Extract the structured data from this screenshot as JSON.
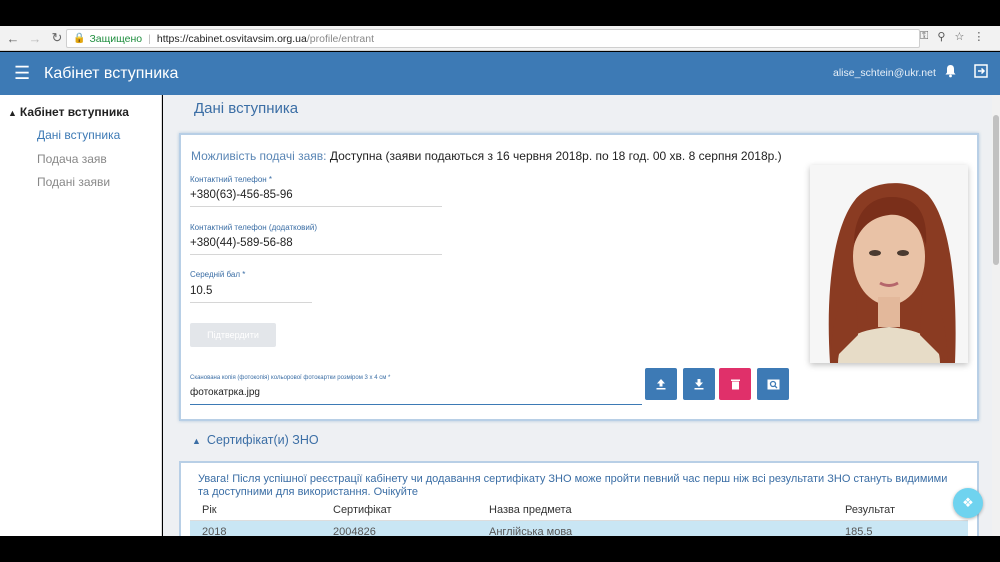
{
  "browser": {
    "secure_label": "Защищено",
    "url_host": "https://cabinet.osvitavsim.org.ua",
    "url_path": "/profile/entrant"
  },
  "header": {
    "title": "Кабінет вступника",
    "user_email": "alise_schtein@ukr.net"
  },
  "sidebar": {
    "heading": "Кабінет вступника",
    "items": [
      {
        "label": "Дані вступника"
      },
      {
        "label": "Подача заяв"
      },
      {
        "label": "Подані заяви"
      }
    ]
  },
  "main": {
    "page_title": "Дані вступника",
    "availability_label": "Можливість подачі заяв:",
    "availability_value": "Доступна (заяви подаються з 16 червня 2018р. по 18 год. 00 хв. 8 серпня 2018р.)",
    "phone_label": "Контактний телефон *",
    "phone_value": "+380(63)-456-85-96",
    "phone2_label": "Контактний телефон (додатковий)",
    "phone2_value": "+380(44)-589-56-88",
    "gpa_label": "Середній бал *",
    "gpa_value": "10.5",
    "confirm_label": "Підтвердити",
    "photo_label": "Сканована копія (фотокопія) кольорової фотокартки розміром 3 x 4 см *",
    "photo_file": "фотокатрка.jpg",
    "certificates_title": "Сертифікат(и) ЗНО",
    "warning": "Увага! Після успішної реєстрації кабінету чи додавання сертифікату ЗНО може пройти певний час перш ніж всі результати ЗНО стануть видимими та доступними для використання. Очікуйте",
    "table": {
      "headers": [
        "Рік",
        "Сертифікат",
        "Назва предмета",
        "Результат"
      ],
      "rows": [
        [
          "2018",
          "2004826",
          "Англійська мова",
          "185.5"
        ]
      ]
    }
  },
  "colors": {
    "appbar": "#3d7ab5",
    "delete_button": "#e0306a",
    "action_button": "#3d7ab5"
  }
}
